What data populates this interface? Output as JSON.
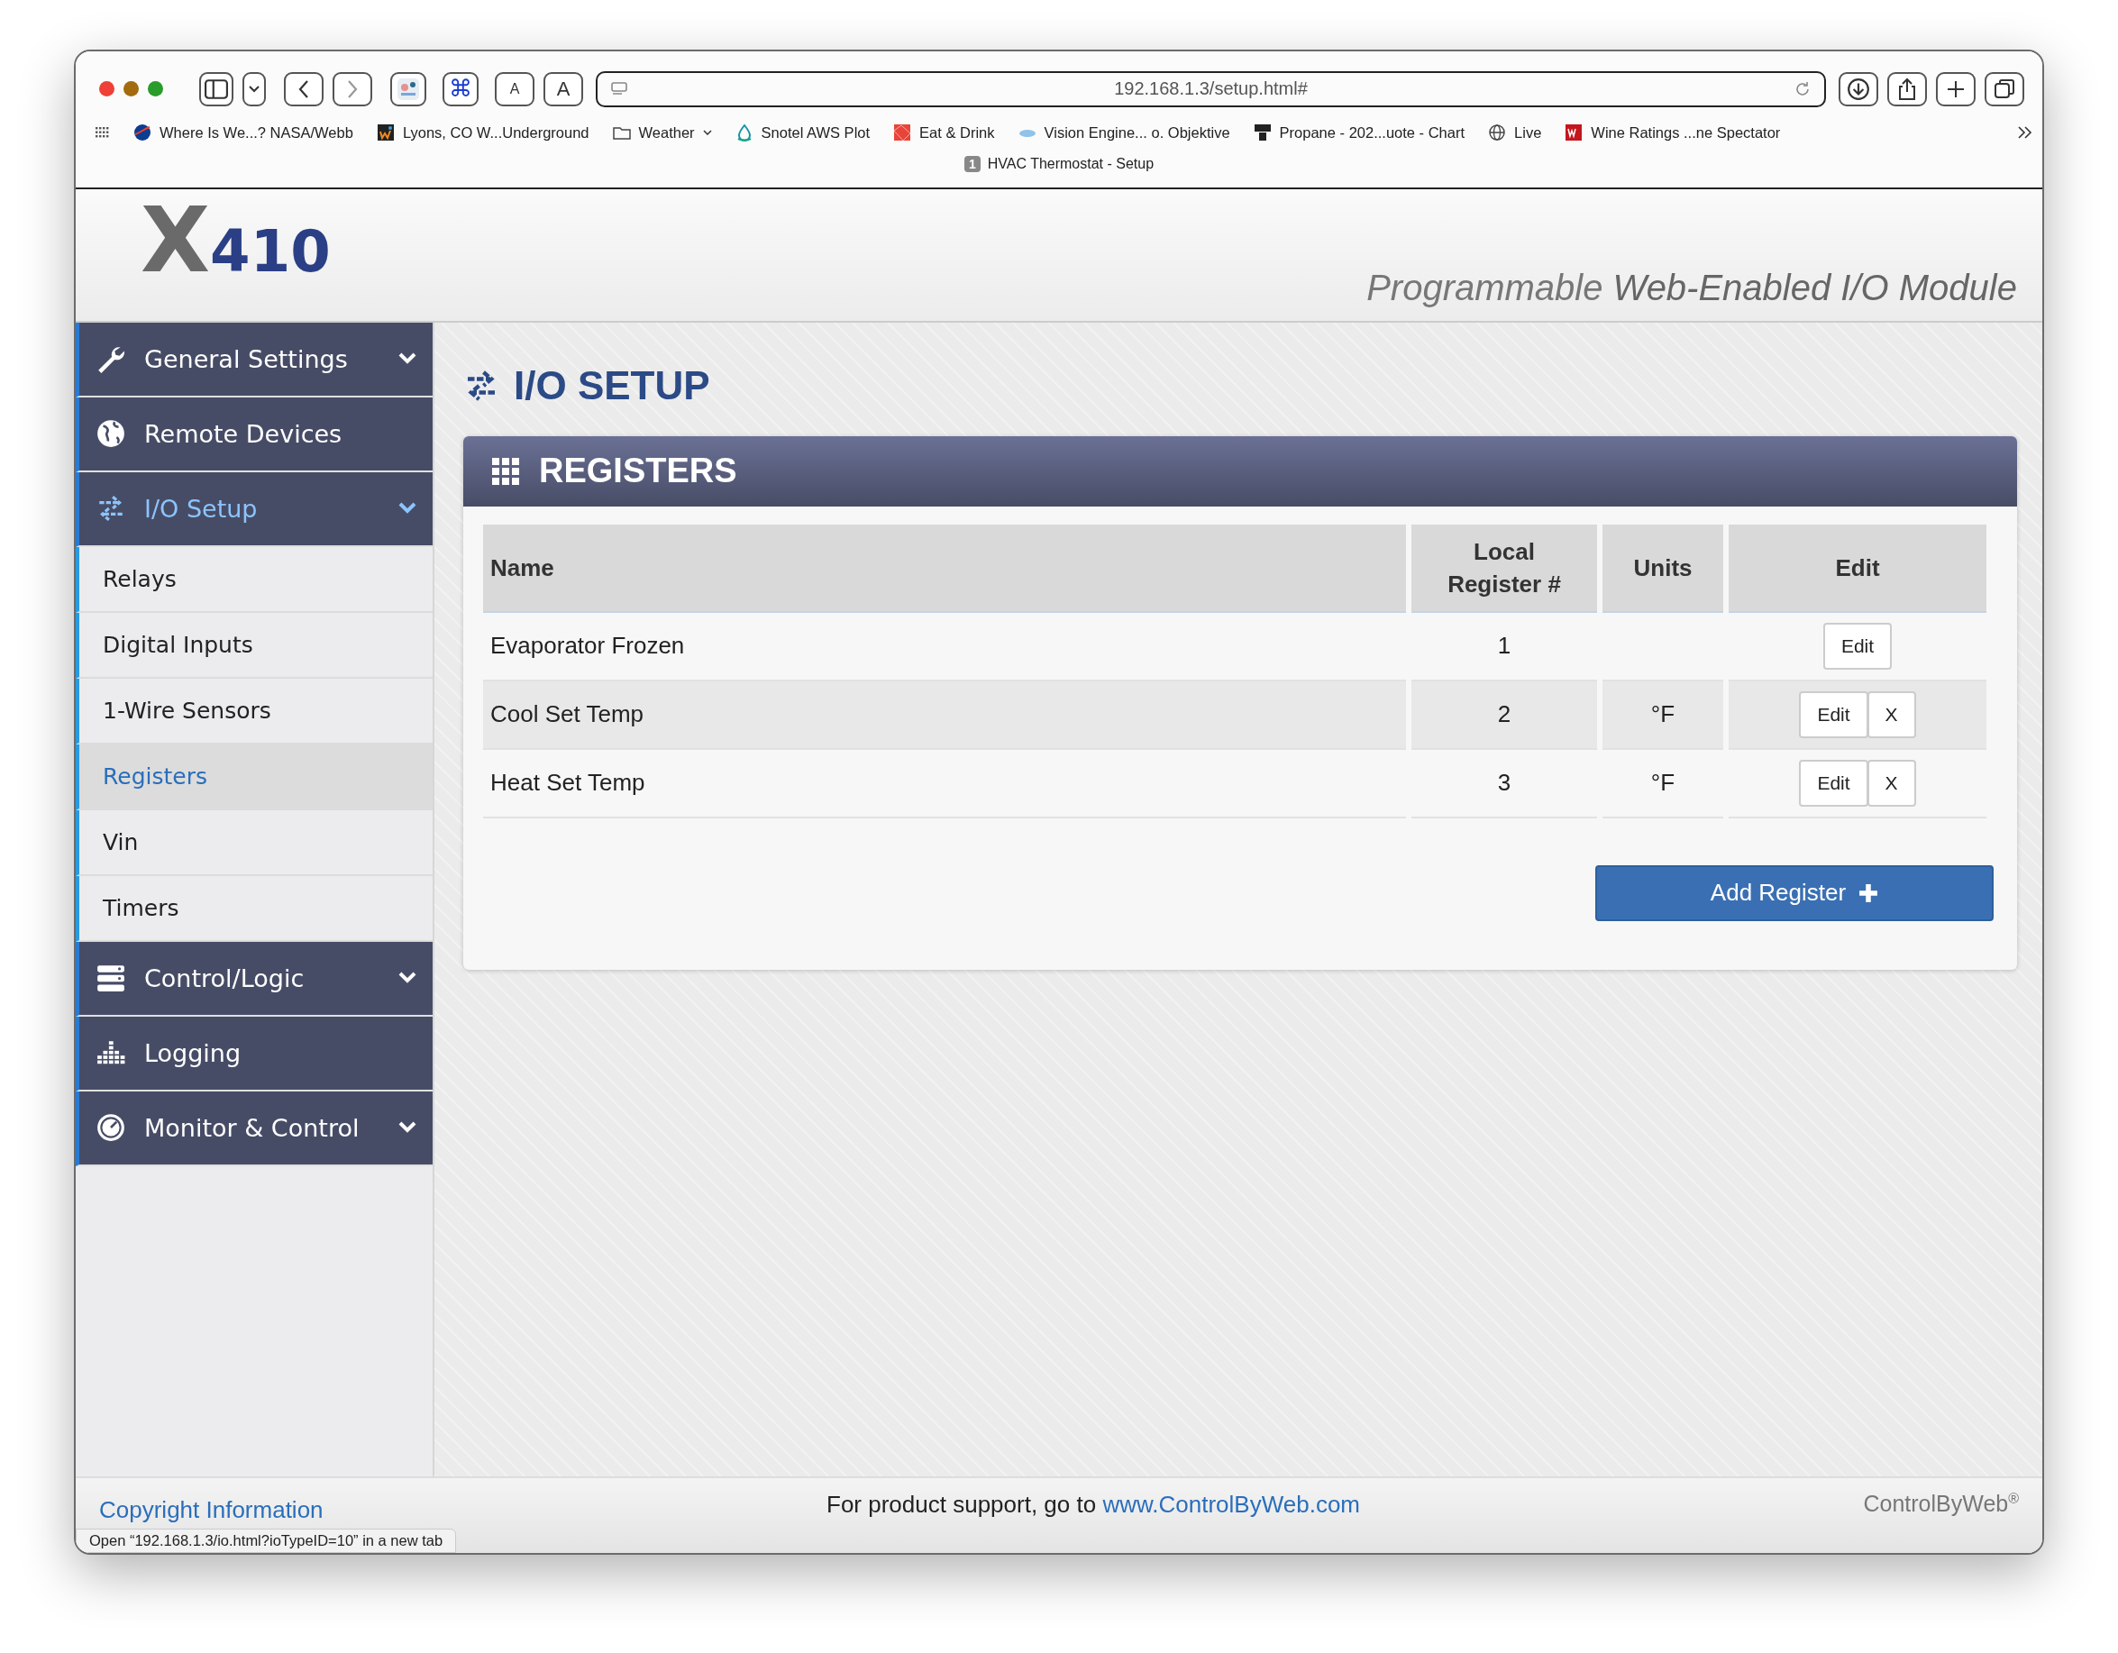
{
  "browser": {
    "text_size_buttons": [
      "A",
      "A"
    ],
    "command_key": "⌘",
    "url": "192.168.1.3/setup.html#",
    "bookmarks": [
      {
        "label": "Where Is We...? NASA/Webb"
      },
      {
        "label": "Lyons, CO W...Underground"
      },
      {
        "label": "Weather",
        "kind": "folder"
      },
      {
        "label": "Snotel AWS Plot"
      },
      {
        "label": "Eat & Drink"
      },
      {
        "label": "Vision Engine... o. Objektive"
      },
      {
        "label": "Propane - 202...uote - Chart"
      },
      {
        "label": "Live"
      },
      {
        "label": "Wine Ratings ...ne Spectator"
      }
    ],
    "tab": {
      "number": "1",
      "title": "HVAC Thermostat - Setup"
    }
  },
  "header": {
    "logo": "X410",
    "tagline": "Programmable **Web-Enabled I/O Module**"
  },
  "sidebar": {
    "items": [
      {
        "label": "General Settings",
        "expandable": true,
        "selected": false
      },
      {
        "label": "Remote Devices",
        "expandable": false,
        "selected": false
      },
      {
        "label": "I/O Setup",
        "expandable": true,
        "selected": true,
        "children": [
          {
            "label": "Relays",
            "selected": false
          },
          {
            "label": "Digital Inputs",
            "selected": false
          },
          {
            "label": "1-Wire Sensors",
            "selected": false
          },
          {
            "label": "Registers",
            "selected": true
          },
          {
            "label": "Vin",
            "selected": false
          },
          {
            "label": "Timers",
            "selected": false
          }
        ]
      },
      {
        "label": "Control/Logic",
        "expandable": true,
        "selected": false
      },
      {
        "label": "Logging",
        "expandable": false,
        "selected": false
      },
      {
        "label": "Monitor & Control",
        "expandable": true,
        "selected": false
      }
    ]
  },
  "page_title": "I/O SETUP",
  "panel": {
    "title": "REGISTERS",
    "table": {
      "columns": [
        "Name",
        "Local Register #",
        "Units",
        "Edit"
      ],
      "rows": [
        {
          "name": "Evaporator Frozen",
          "register": "1",
          "buttons": [
            "Edit"
          ]
        },
        {
          "name": "Cool Set Temp",
          "register": "2",
          "units": "°F",
          "buttons": [
            "Edit",
            "X"
          ]
        },
        {
          "name": "Heat Set Temp",
          "register": "3",
          "units": "°F",
          "buttons": [
            "Edit",
            "X"
          ]
        }
      ]
    },
    "add_button": "Add Register"
  },
  "footer": {
    "copyright_link": "Copyright Information",
    "support_text": "For product support, go to ",
    "support_link": "www.ControlByWeb.com",
    "brand": "ControlByWeb$^{®}$"
  },
  "status_tooltip": "Open “192.168.1.3/io.html?ioTypeID=10” in a new tab"
}
